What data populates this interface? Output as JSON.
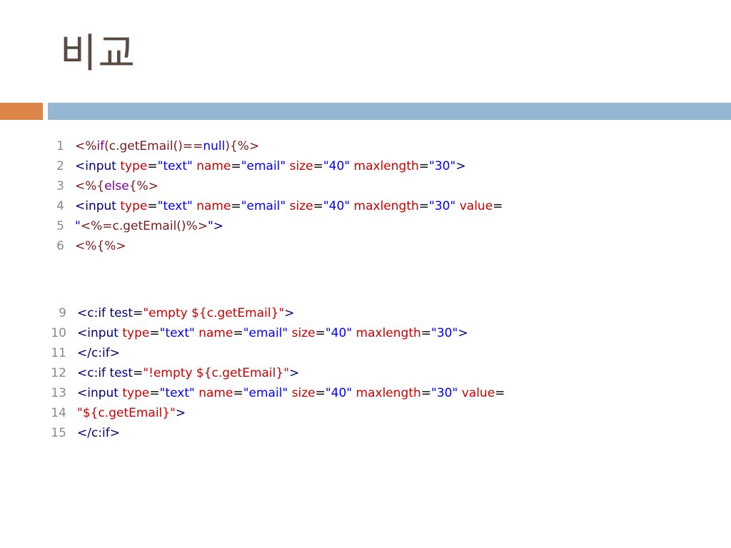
{
  "slide": {
    "title": "비교"
  },
  "colors": {
    "accent_bar": "#dd8448",
    "main_bar": "#94b6d2",
    "title": "#5b4a44"
  },
  "code_blocks": [
    {
      "lines": [
        {
          "num": "1",
          "tokens": [
            {
              "t": "<%",
              "c": "jsp"
            },
            {
              "t": "if",
              "c": "kw"
            },
            {
              "t": "(c.getEmail()==",
              "c": "jsp"
            },
            {
              "t": "null",
              "c": "str"
            },
            {
              "t": "){%>",
              "c": "jsp"
            }
          ]
        },
        {
          "num": "2",
          "tokens": [
            {
              "t": "<input ",
              "c": "tag"
            },
            {
              "t": "type",
              "c": "attr"
            },
            {
              "t": "=",
              "c": "txt"
            },
            {
              "t": "\"text\"",
              "c": "str"
            },
            {
              "t": " name",
              "c": "attr"
            },
            {
              "t": "=",
              "c": "txt"
            },
            {
              "t": "\"email\"",
              "c": "str"
            },
            {
              "t": " size",
              "c": "attr"
            },
            {
              "t": "=",
              "c": "txt"
            },
            {
              "t": "\"40\"",
              "c": "str"
            },
            {
              "t": " maxlength",
              "c": "attr"
            },
            {
              "t": "=",
              "c": "txt"
            },
            {
              "t": "\"30\"",
              "c": "str"
            },
            {
              "t": ">",
              "c": "tag"
            }
          ]
        },
        {
          "num": "3",
          "tokens": [
            {
              "t": "<%{",
              "c": "jsp"
            },
            {
              "t": "else",
              "c": "kw"
            },
            {
              "t": "{%>",
              "c": "jsp"
            }
          ]
        },
        {
          "num": "4",
          "tokens": [
            {
              "t": "<input ",
              "c": "tag"
            },
            {
              "t": "type",
              "c": "attr"
            },
            {
              "t": "=",
              "c": "txt"
            },
            {
              "t": "\"text\"",
              "c": "str"
            },
            {
              "t": " name",
              "c": "attr"
            },
            {
              "t": "=",
              "c": "txt"
            },
            {
              "t": "\"email\"",
              "c": "str"
            },
            {
              "t": " size",
              "c": "attr"
            },
            {
              "t": "=",
              "c": "txt"
            },
            {
              "t": "\"40\"",
              "c": "str"
            },
            {
              "t": " maxlength",
              "c": "attr"
            },
            {
              "t": "=",
              "c": "txt"
            },
            {
              "t": "\"30\"",
              "c": "str"
            },
            {
              "t": " value",
              "c": "attr"
            },
            {
              "t": "=",
              "c": "txt"
            }
          ]
        },
        {
          "num": "5",
          "tokens": [
            {
              "t": "\"",
              "c": "str"
            },
            {
              "t": "<%=c.getEmail()%>",
              "c": "jsp"
            },
            {
              "t": "\"",
              "c": "str"
            },
            {
              "t": ">",
              "c": "tag"
            }
          ]
        },
        {
          "num": "6",
          "tokens": [
            {
              "t": "<%{%>",
              "c": "jsp"
            }
          ]
        }
      ]
    },
    {
      "lines": [
        {
          "num": "9",
          "tokens": [
            {
              "t": "<c:if ",
              "c": "jstl"
            },
            {
              "t": "test",
              "c": "jstl"
            },
            {
              "t": "=",
              "c": "txt"
            },
            {
              "t": "\"empty ${c.getEmail}\"",
              "c": "attr"
            },
            {
              "t": ">",
              "c": "jstl"
            }
          ]
        },
        {
          "num": "10",
          "tokens": [
            {
              "t": "<input ",
              "c": "tag"
            },
            {
              "t": "type",
              "c": "attr"
            },
            {
              "t": "=",
              "c": "txt"
            },
            {
              "t": "\"text\"",
              "c": "str"
            },
            {
              "t": " name",
              "c": "attr"
            },
            {
              "t": "=",
              "c": "txt"
            },
            {
              "t": "\"email\"",
              "c": "str"
            },
            {
              "t": " size",
              "c": "attr"
            },
            {
              "t": "=",
              "c": "txt"
            },
            {
              "t": "\"40\"",
              "c": "str"
            },
            {
              "t": " maxlength",
              "c": "attr"
            },
            {
              "t": "=",
              "c": "txt"
            },
            {
              "t": "\"30\"",
              "c": "str"
            },
            {
              "t": ">",
              "c": "tag"
            }
          ]
        },
        {
          "num": "11",
          "tokens": [
            {
              "t": "</c:if>",
              "c": "jstl"
            }
          ]
        },
        {
          "num": "12",
          "tokens": [
            {
              "t": "<c:if ",
              "c": "jstl"
            },
            {
              "t": "test",
              "c": "jstl"
            },
            {
              "t": "=",
              "c": "txt"
            },
            {
              "t": "\"!empty ${c.getEmail}\"",
              "c": "attr"
            },
            {
              "t": ">",
              "c": "jstl"
            }
          ]
        },
        {
          "num": "13",
          "tokens": [
            {
              "t": "<input ",
              "c": "tag"
            },
            {
              "t": "type",
              "c": "attr"
            },
            {
              "t": "=",
              "c": "txt"
            },
            {
              "t": "\"text\"",
              "c": "str"
            },
            {
              "t": " name",
              "c": "attr"
            },
            {
              "t": "=",
              "c": "txt"
            },
            {
              "t": "\"email\"",
              "c": "str"
            },
            {
              "t": " size",
              "c": "attr"
            },
            {
              "t": "=",
              "c": "txt"
            },
            {
              "t": "\"40\"",
              "c": "str"
            },
            {
              "t": " maxlength",
              "c": "attr"
            },
            {
              "t": "=",
              "c": "txt"
            },
            {
              "t": "\"30\"",
              "c": "str"
            },
            {
              "t": " value",
              "c": "attr"
            },
            {
              "t": "=",
              "c": "txt"
            }
          ]
        },
        {
          "num": "14",
          "tokens": [
            {
              "t": "\"${c.getEmail}\"",
              "c": "attr"
            },
            {
              "t": ">",
              "c": "tag"
            }
          ]
        },
        {
          "num": "15",
          "tokens": [
            {
              "t": "</c:if>",
              "c": "jstl"
            }
          ]
        }
      ]
    }
  ]
}
